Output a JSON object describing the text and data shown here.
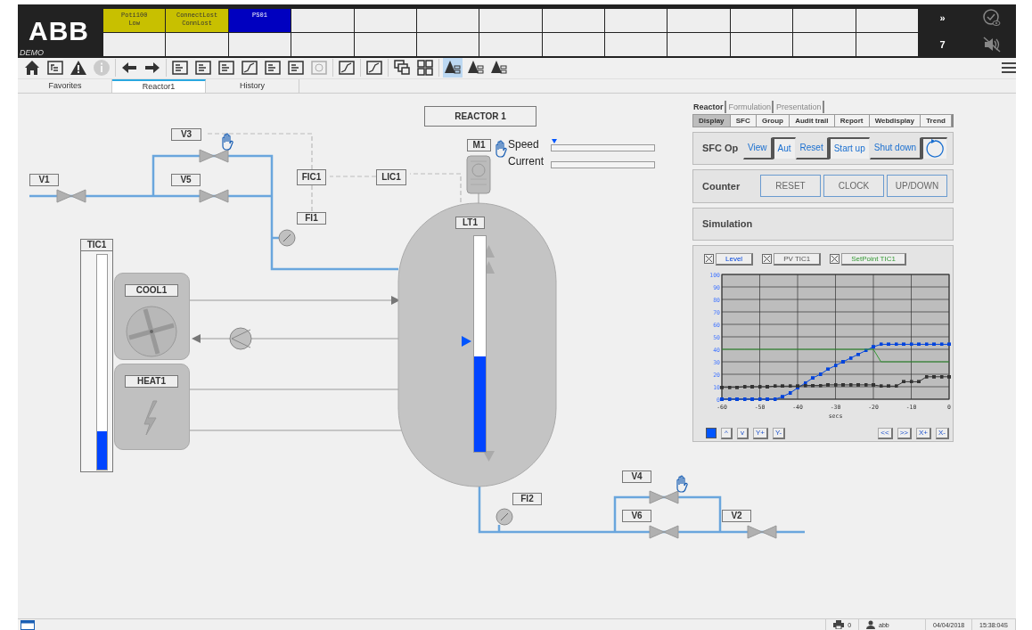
{
  "header": {
    "logo": "ABB",
    "mode": "DEMO",
    "alarms": [
      {
        "lines": [
          "Poti100",
          "Low"
        ],
        "color": "#c8c000"
      },
      {
        "lines": [
          "ConnectLost",
          "ConnLost"
        ],
        "color": "#c8c000"
      },
      {
        "lines": [
          "PS01"
        ],
        "color": "#0000c0"
      }
    ],
    "more": "»",
    "count": "7"
  },
  "toolbar": [
    {
      "kind": "home",
      "selected": false,
      "disabled": false
    },
    {
      "kind": "tree",
      "selected": false,
      "disabled": false
    },
    {
      "kind": "warning",
      "selected": false,
      "disabled": false
    },
    {
      "kind": "info",
      "selected": false,
      "disabled": true
    },
    {
      "kind": "back",
      "selected": false,
      "disabled": false
    },
    {
      "kind": "forward",
      "selected": false,
      "disabled": false
    },
    {
      "kind": "panel",
      "selected": false,
      "disabled": false
    },
    {
      "kind": "panel",
      "selected": false,
      "disabled": false
    },
    {
      "kind": "panel",
      "selected": false,
      "disabled": false
    },
    {
      "kind": "trend",
      "selected": false,
      "disabled": false
    },
    {
      "kind": "panel",
      "selected": false,
      "disabled": false
    },
    {
      "kind": "panel",
      "selected": false,
      "disabled": false
    },
    {
      "kind": "globe",
      "selected": false,
      "disabled": true
    },
    {
      "kind": "trend",
      "selected": false,
      "disabled": false
    },
    {
      "kind": "trend",
      "selected": false,
      "disabled": false
    },
    {
      "kind": "windows",
      "selected": false,
      "disabled": false
    },
    {
      "kind": "grid",
      "selected": false,
      "disabled": false
    },
    {
      "kind": "alarm",
      "selected": true,
      "disabled": false
    },
    {
      "kind": "alarm",
      "selected": false,
      "disabled": false
    },
    {
      "kind": "alarm",
      "selected": false,
      "disabled": false
    }
  ],
  "tabs": [
    {
      "label": "Favorites",
      "selected": false
    },
    {
      "label": "Reactor1",
      "selected": true
    },
    {
      "label": "History",
      "selected": false
    }
  ],
  "process": {
    "title": "REACTOR 1",
    "tags": [
      {
        "label": "V3"
      },
      {
        "label": "V1"
      },
      {
        "label": "V5"
      },
      {
        "label": "FIC1"
      },
      {
        "label": "LIC1"
      },
      {
        "label": "FI1"
      },
      {
        "label": "M1"
      },
      {
        "label": "LT1"
      },
      {
        "label": "TIC1"
      },
      {
        "label": "COOL1"
      },
      {
        "label": "HEAT1"
      },
      {
        "label": "FI2"
      },
      {
        "label": "V4"
      },
      {
        "label": "V6"
      },
      {
        "label": "V2"
      }
    ],
    "motor_bars": [
      {
        "label": "Speed",
        "level": 0
      },
      {
        "label": "Current",
        "level": 0
      }
    ],
    "tank_level": {
      "level": 0.44
    },
    "temperature": {
      "level": 0.18
    }
  },
  "panel": {
    "tabs": [
      {
        "label": "Reactor",
        "selected": true
      },
      {
        "label": "Formulation",
        "selected": false
      },
      {
        "label": "Presentation",
        "selected": false
      }
    ],
    "subtabs": [
      {
        "label": "Display",
        "selected": true
      },
      {
        "label": "SFC",
        "selected": false
      },
      {
        "label": "Group",
        "selected": false
      },
      {
        "label": "Audit trail",
        "selected": false
      },
      {
        "label": "Report",
        "selected": false
      },
      {
        "label": "Webdisplay",
        "selected": false
      },
      {
        "label": "Trend",
        "selected": false
      }
    ],
    "sfc": {
      "label": "SFC Op",
      "buttons": [
        {
          "label": "View",
          "pressed": false
        },
        {
          "label": "Aut",
          "pressed": true
        },
        {
          "label": "Reset",
          "pressed": false
        },
        {
          "label": "Start up",
          "pressed": true
        },
        {
          "label": "Shut down",
          "pressed": false
        }
      ]
    },
    "counter": {
      "label": "Counter",
      "buttons": [
        "RESET",
        "CLOCK",
        "UP/DOWN"
      ]
    },
    "simulation": {
      "label": "Simulation"
    },
    "trend_legend": [
      {
        "checked": true
      },
      {
        "checked": true
      },
      {
        "checked": true
      }
    ],
    "chart_data": {
      "type": "line",
      "xlabel": "secs",
      "grid": true,
      "x": [
        -60,
        -58,
        -56,
        -54,
        -52,
        -50,
        -48,
        -46,
        -44,
        -42,
        -40,
        -38,
        -36,
        -34,
        -32,
        -30,
        -28,
        -26,
        -24,
        -22,
        -20,
        -18,
        -16,
        -14,
        -12,
        -10,
        -8,
        -6,
        -4,
        -2,
        0
      ],
      "series": [
        {
          "name": "Level",
          "color": "#0044dd",
          "values": [
            0,
            0,
            0,
            0,
            0,
            0,
            0,
            0,
            2,
            5,
            9,
            13,
            17,
            20,
            24,
            27,
            30,
            33,
            36,
            39,
            42,
            44,
            44,
            44,
            44,
            44,
            44,
            44,
            44,
            44,
            44
          ]
        },
        {
          "name": "PV TIC1",
          "color": "#333333",
          "values": [
            9.5,
            9.5,
            9.5,
            10,
            10,
            10,
            10,
            10.5,
            10.5,
            10.5,
            10.5,
            11,
            11,
            11,
            11.5,
            11.5,
            11.5,
            11.5,
            11.5,
            11.5,
            11.5,
            10.5,
            10.5,
            10.5,
            14,
            14,
            14,
            18,
            18,
            18,
            18
          ]
        },
        {
          "name": "SetPoint TIC1",
          "color": "#339933",
          "values": [
            40,
            40,
            40,
            40,
            40,
            40,
            40,
            40,
            40,
            40,
            40,
            40,
            40,
            40,
            40,
            40,
            40,
            40,
            40,
            40,
            40,
            30,
            30,
            30,
            30,
            30,
            30,
            30,
            30,
            30,
            30
          ]
        }
      ],
      "xlim": [
        -60,
        0
      ],
      "ylim": [
        0,
        100
      ],
      "xticks": [
        -60,
        -50,
        -40,
        -30,
        -20,
        -10,
        0
      ],
      "yticks": [
        0,
        10,
        20,
        30,
        40,
        50,
        60,
        70,
        80,
        90,
        100
      ]
    },
    "chart_buttons": [
      "^",
      "v",
      "Y+",
      "Y-",
      "<<",
      ">>",
      "X+",
      "X-"
    ]
  },
  "status_bar": {
    "printers": "0",
    "user": "abb",
    "date": "04/04/2018",
    "time": "15:38:04S"
  }
}
